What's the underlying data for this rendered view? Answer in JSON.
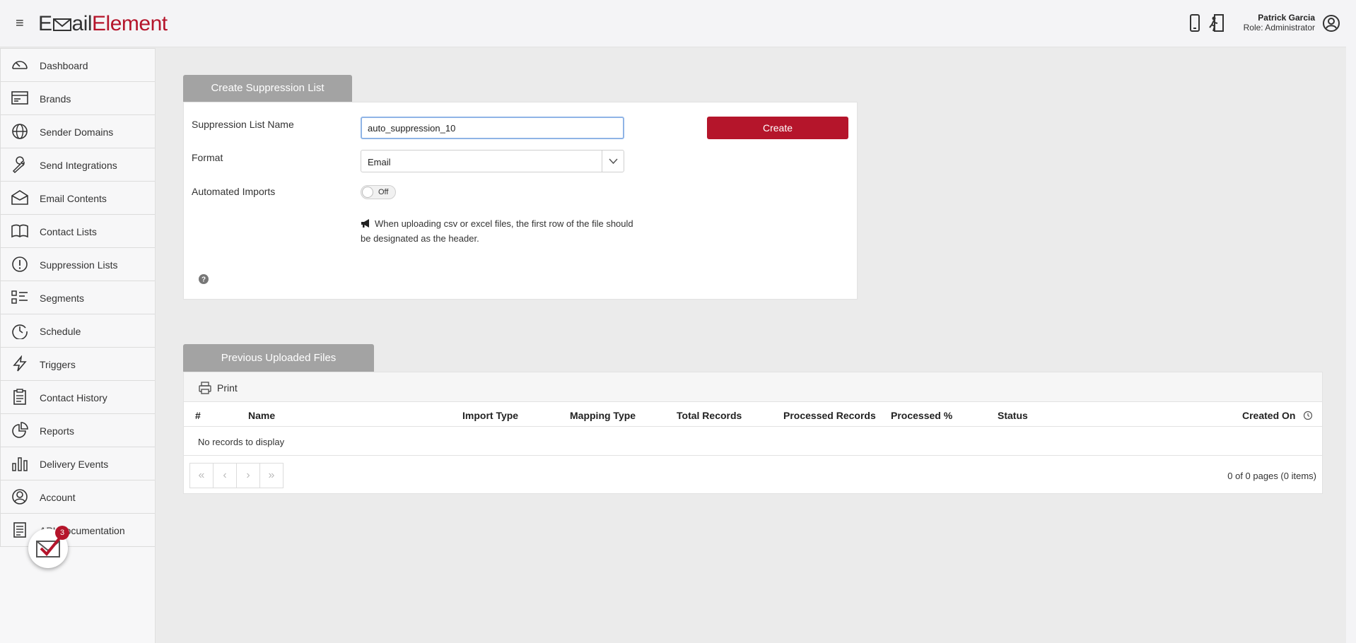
{
  "header": {
    "logo_part1": "E",
    "logo_part2": "ail",
    "logo_part3": "Element",
    "user_name": "Patrick Garcia",
    "user_role": "Role: Administrator",
    "accent_color": "#b5152b"
  },
  "sidebar": {
    "items": [
      {
        "label": "Dashboard",
        "icon": "dashboard-gauge-icon"
      },
      {
        "label": "Brands",
        "icon": "brands-card-icon"
      },
      {
        "label": "Sender Domains",
        "icon": "globe-icon"
      },
      {
        "label": "Send Integrations",
        "icon": "wrench-icon"
      },
      {
        "label": "Email Contents",
        "icon": "envelope-open-icon"
      },
      {
        "label": "Contact Lists",
        "icon": "book-icon"
      },
      {
        "label": "Suppression Lists",
        "icon": "exclamation-circle-icon"
      },
      {
        "label": "Segments",
        "icon": "list-segments-icon"
      },
      {
        "label": "Schedule",
        "icon": "clock-history-icon"
      },
      {
        "label": "Triggers",
        "icon": "lightning-icon"
      },
      {
        "label": "Contact History",
        "icon": "clipboard-icon"
      },
      {
        "label": "Reports",
        "icon": "pie-chart-icon"
      },
      {
        "label": "Delivery Events",
        "icon": "bar-chart-icon"
      },
      {
        "label": "Account",
        "icon": "person-circle-icon"
      },
      {
        "label": "API Documentation",
        "icon": "document-icon"
      }
    ],
    "notification_count": "3"
  },
  "create_form": {
    "tab_title": "Create Suppression List",
    "name_label": "Suppression List Name",
    "name_value": "auto_suppression_10",
    "format_label": "Format",
    "format_value": "Email",
    "automated_label": "Automated Imports",
    "toggle_text": "Off",
    "note_text": "When uploading csv or excel files, the first row of the file should be designated as the header.",
    "create_label": "Create"
  },
  "files": {
    "tab_title": "Previous Uploaded Files",
    "print_label": "Print",
    "columns": [
      "#",
      "Name",
      "Import Type",
      "Mapping Type",
      "Total Records",
      "Processed Records",
      "Processed %",
      "Status",
      "Created On"
    ],
    "empty_text": "No records to display",
    "pager_info": "0 of 0 pages (0 items)"
  }
}
